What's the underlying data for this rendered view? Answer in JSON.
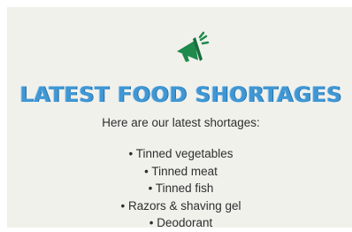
{
  "header": {
    "icon": "megaphone-icon",
    "title": "LATEST FOOD SHORTAGES"
  },
  "intro": "Here are our latest shortages:",
  "shortages": [
    "Tinned vegetables",
    "Tinned meat",
    "Tinned fish",
    "Razors & shaving gel",
    "Deodorant"
  ],
  "colors": {
    "panel_background": "#f1f1ec",
    "title": "#3f97d4",
    "icon": "#1e8a4c",
    "text": "#2e2e2e"
  }
}
